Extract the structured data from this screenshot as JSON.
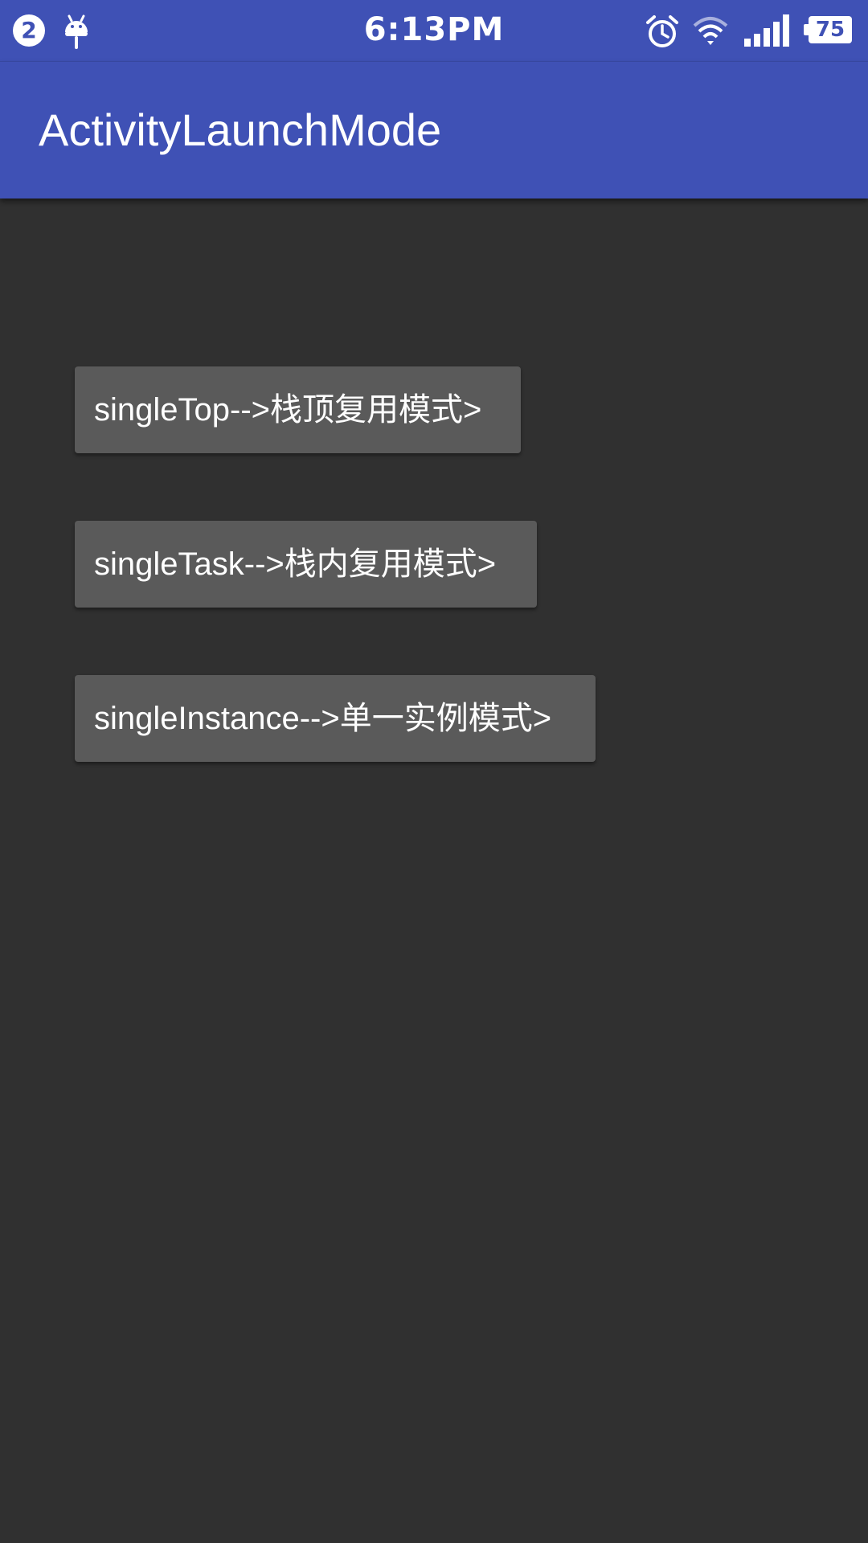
{
  "status_bar": {
    "notification_count": "2",
    "time": "6:13PM",
    "battery_level": "75",
    "icons": [
      "notification-badge",
      "android-debug-icon",
      "alarm-icon",
      "wifi-icon",
      "cell-signal-icon",
      "battery-icon"
    ]
  },
  "app_bar": {
    "title": "ActivityLaunchMode"
  },
  "buttons": [
    {
      "label": "singleTop-->栈顶复用模式>"
    },
    {
      "label": "singleTask-->栈内复用模式>"
    },
    {
      "label": "singleInstance-->单一实例模式>"
    }
  ],
  "colors": {
    "primary": "#3F51B5",
    "background": "#303030",
    "button": "#5A5A5A",
    "text": "#FFFFFF"
  }
}
